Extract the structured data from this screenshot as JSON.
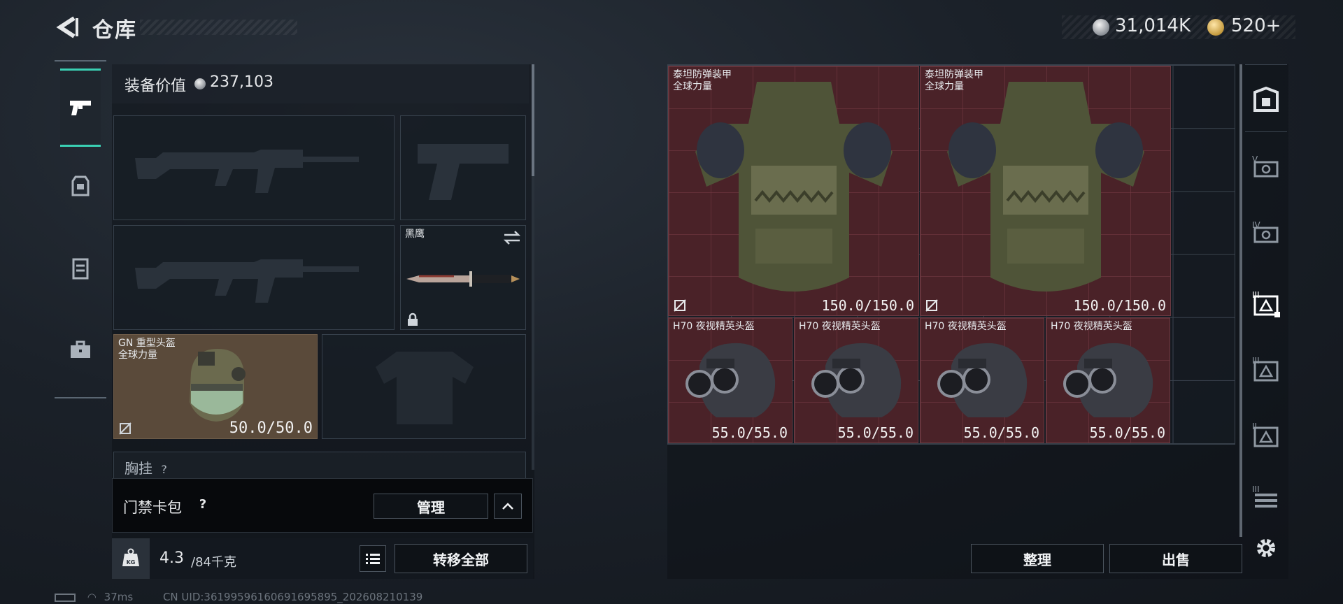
{
  "header": {
    "title": "仓库",
    "currency": [
      {
        "icon": "silver-coin-icon",
        "value": "31,014K"
      },
      {
        "icon": "gold-coin-icon",
        "value": "520+"
      }
    ]
  },
  "left_sidebar": {
    "tabs": [
      {
        "icon": "pistol-icon",
        "active": true
      },
      {
        "icon": "helmet-armor-icon",
        "active": false
      },
      {
        "icon": "vest-icon",
        "active": false
      },
      {
        "icon": "briefcase-icon",
        "active": false
      }
    ]
  },
  "equipment": {
    "value_label": "装备价值",
    "value": "237,103",
    "slots": {
      "primary_1": {
        "name": "",
        "icon": "assault-rifle-silhouette-icon"
      },
      "pistol": {
        "name": "",
        "icon": "pistol-silhouette-icon"
      },
      "primary_2": {
        "name": "",
        "icon": "assault-rifle-silhouette-icon"
      },
      "melee": {
        "name": "黑鹰",
        "icon": "knife-icon"
      },
      "helmet": {
        "name": "GN 重型头盔",
        "subtitle": "全球力量",
        "durability": "50.0/50.0"
      },
      "armor": {
        "name": "",
        "icon": "armor-silhouette-icon"
      }
    },
    "chest_label": "胸挂",
    "chest_count": "?"
  },
  "keycard": {
    "label": "门禁卡包",
    "help": "?",
    "manage_label": "管理"
  },
  "weight": {
    "icon_label": "KG",
    "current": "4.3",
    "max": "/84千克",
    "transfer_label": "转移全部"
  },
  "storage": {
    "armors": [
      {
        "name": "泰坦防弹装甲",
        "subtitle": "全球力量",
        "durability": "150.0/150.0"
      },
      {
        "name": "泰坦防弹装甲",
        "subtitle": "全球力量",
        "durability": "150.0/150.0"
      }
    ],
    "helmets": [
      {
        "name": "H70 夜视精英头盔",
        "durability": "55.0/55.0"
      },
      {
        "name": "H70 夜视精英头盔",
        "durability": "55.0/55.0"
      },
      {
        "name": "H70 夜视精英头盔",
        "durability": "55.0/55.0"
      },
      {
        "name": "H70 夜视精英头盔",
        "durability": "55.0/55.0"
      }
    ],
    "organize_label": "整理",
    "sell_label": "出售"
  },
  "right_sidebar": {
    "tabs": [
      "safe-box-icon",
      "level-v-armor-icon",
      "level-iv-armor-icon",
      "level-iii-armor-active-icon",
      "level-iii-armor-icon",
      "level-ii-armor-icon",
      "level-i-armor-icon"
    ]
  },
  "status": {
    "ping": "37ms",
    "uid": "CN UID:3619959616069169589​5_202608210139"
  },
  "colors": {
    "accent": "#3ad0b3",
    "item_highlight": "#4a2228",
    "helmet_slot": "#5a4a3a"
  }
}
